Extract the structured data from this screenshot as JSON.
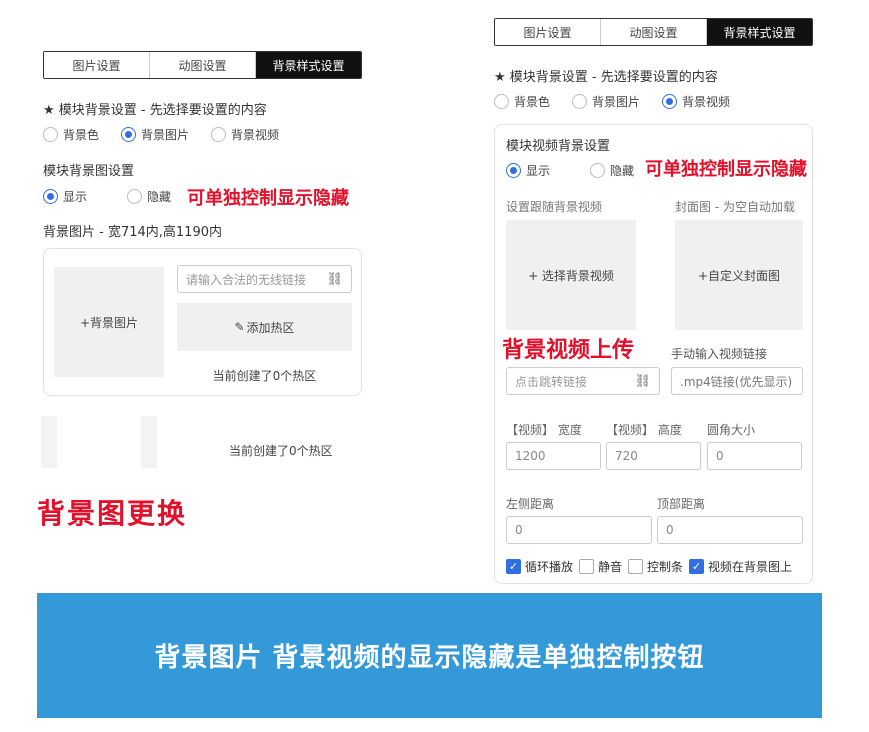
{
  "tabs": [
    "图片设置",
    "动图设置",
    "背景样式设置"
  ],
  "module_bg_title": "★ 模块背景设置 - 先选择要设置的内容",
  "bg_types": [
    "背景色",
    "背景图片",
    "背景视频"
  ],
  "left": {
    "section_title": "模块背景图设置",
    "show_label": "显示",
    "hide_label": "隐藏",
    "annotation_toggle": "可单独控制显示隐藏",
    "size_hint": "背景图片 - 宽714内,高1190内",
    "bg_image_btn": "+背景图片",
    "link_placeholder": "请输入合法的无线链接",
    "add_hotspot": "添加热区",
    "hotspot_count": "当前创建了0个热区",
    "hotspot_count_2": "当前创建了0个热区",
    "annotation_change": "背景图更换"
  },
  "right": {
    "section_title": "模块视频背景设置",
    "show_label": "显示",
    "hide_label": "隐藏",
    "annotation_toggle": "可单独控制显示隐藏",
    "video_follow_label": "设置跟随背景视频",
    "cover_label": "封面图 - 为空自动加载",
    "choose_video_btn": "+ 选择背景视频",
    "custom_cover_btn": "+自定义封面图",
    "annotation_upload": "背景视频上传",
    "manual_link_label": "手动输入视频链接",
    "jump_link_placeholder": "点击跳转链接",
    "mp4_placeholder": ".mp4链接(优先显示)",
    "width_label": "【视频】 宽度",
    "height_label": "【视频】 高度",
    "radius_label": "圆角大小",
    "width_value": "1200",
    "height_value": "720",
    "radius_value": "0",
    "left_label": "左侧距离",
    "top_label": "顶部距离",
    "left_value": "0",
    "top_value": "0",
    "checkboxes": [
      {
        "label": "循环播放",
        "checked": true
      },
      {
        "label": "静音",
        "checked": false
      },
      {
        "label": "控制条",
        "checked": false
      },
      {
        "label": "视频在背景图上",
        "checked": true
      }
    ]
  },
  "banner_text": "背景图片 背景视频的显示隐藏是单独控制按钮",
  "colors": {
    "accent": "#2f6fe0",
    "annotation": "#e3102b",
    "banner": "#3399d8"
  }
}
